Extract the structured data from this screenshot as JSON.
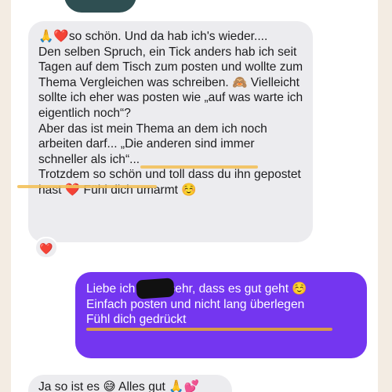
{
  "messages": {
    "incoming_1": {
      "emoji_prefix": "🙏❤️",
      "text": "so schön. Und da hab ich's wieder....\nDen selben Spruch, ein Tick anders hab ich seit Tagen auf dem Tisch zum posten und wollte zum Thema Vergleichen was schreiben. 🙈 Vielleicht sollte ich eher was posten wie „auf was warte ich eigentlich noch“?\nAber das ist mein Thema an dem ich noch arbeiten darf... „Die anderen sind immer schneller als ich“...\nTrotzdem so schön und toll dass du ihn gepostet hast ❤️ Fühl dich umarmt ☺️",
      "reaction": "❤️"
    },
    "outgoing_1": {
      "text": "Liebe          ich hoffe sehr, dass es gut geht ☺️\nEinfach posten und nicht lang überlegen\nFühl dich gedrückt"
    },
    "incoming_2": {
      "text": "Ja so ist es 😅 Alles gut 🙏💕"
    }
  },
  "colors": {
    "incoming_bubble": "#ececef",
    "outgoing_bubble": "#7436f0",
    "highlight": "#f3c15a",
    "background": "#f3ece3"
  }
}
